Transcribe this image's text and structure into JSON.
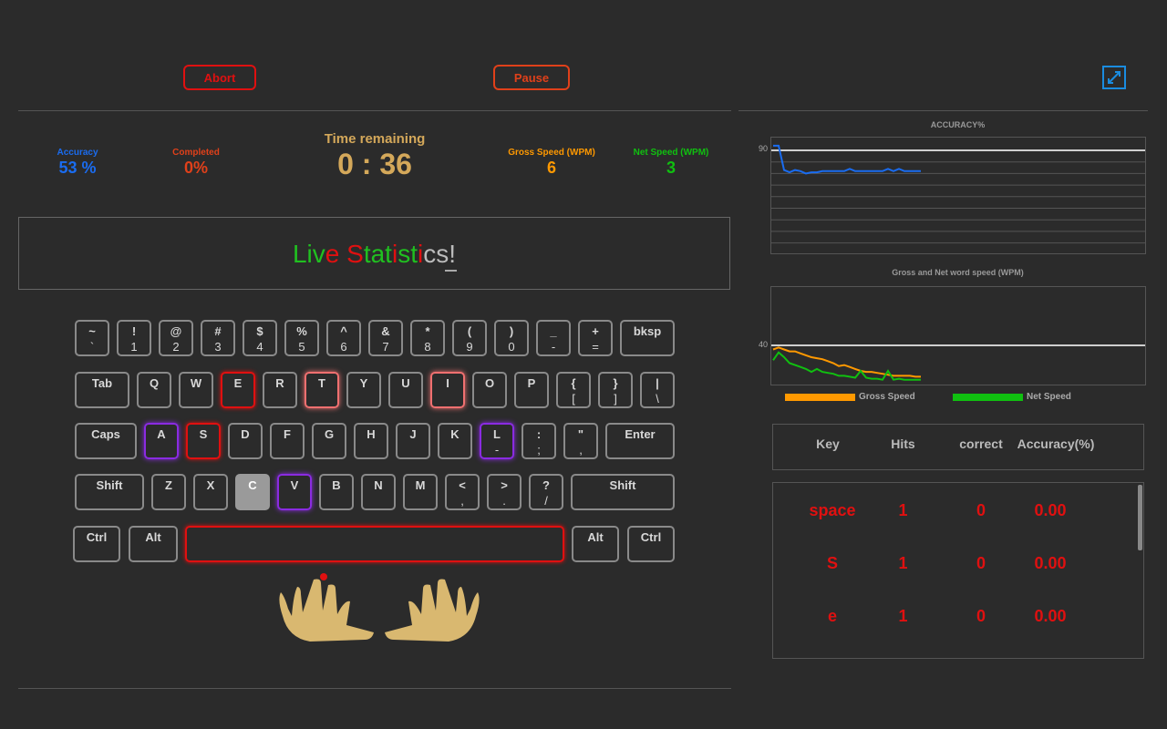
{
  "buttons": {
    "abort": "Abort",
    "pause": "Pause"
  },
  "stats": {
    "accuracy_label": "Accuracy",
    "accuracy_value": "53 %",
    "completed_label": "Completed",
    "completed_value": "0%",
    "time_label": "Time remaining",
    "time_value": "0 : 36",
    "gross_label": "Gross Speed (WPM)",
    "gross_value": "6",
    "net_label": "Net Speed (WPM)",
    "net_value": "3"
  },
  "live_text": {
    "segments": [
      {
        "text": "Liv",
        "color": "#20c020"
      },
      {
        "text": "e",
        "color": "#e01010"
      },
      {
        "text": " ",
        "color": "#d8d8d8"
      },
      {
        "text": "S",
        "color": "#e01010"
      },
      {
        "text": "tat",
        "color": "#20c020"
      },
      {
        "text": "i",
        "color": "#e01010"
      },
      {
        "text": "st",
        "color": "#20c020"
      },
      {
        "text": "i",
        "color": "#e01010"
      },
      {
        "text": "cs",
        "color": "#bbbbbb"
      },
      {
        "text": "!",
        "color": "#bbbbbb"
      }
    ]
  },
  "keyboard": {
    "row1": [
      [
        "~",
        "`"
      ],
      [
        "!",
        "1"
      ],
      [
        "@",
        "2"
      ],
      [
        "#",
        "3"
      ],
      [
        "$",
        "4"
      ],
      [
        "%",
        "5"
      ],
      [
        "^",
        "6"
      ],
      [
        "&",
        "7"
      ],
      [
        "*",
        "8"
      ],
      [
        "(",
        "9"
      ],
      [
        ")",
        "0"
      ],
      [
        "_",
        "-"
      ],
      [
        "+",
        "="
      ],
      [
        "bksp",
        ""
      ]
    ],
    "row2": [
      [
        "Tab",
        ""
      ],
      [
        "Q",
        ""
      ],
      [
        "W",
        ""
      ],
      [
        "E",
        ""
      ],
      [
        "R",
        ""
      ],
      [
        "T",
        ""
      ],
      [
        "Y",
        ""
      ],
      [
        "U",
        ""
      ],
      [
        "I",
        ""
      ],
      [
        "O",
        ""
      ],
      [
        "P",
        ""
      ],
      [
        "{",
        "["
      ],
      [
        "}",
        "]"
      ],
      [
        "|",
        "\\"
      ]
    ],
    "row3": [
      [
        "Caps",
        ""
      ],
      [
        "A",
        ""
      ],
      [
        "S",
        ""
      ],
      [
        "D",
        ""
      ],
      [
        "F",
        ""
      ],
      [
        "G",
        ""
      ],
      [
        "H",
        ""
      ],
      [
        "J",
        ""
      ],
      [
        "K",
        ""
      ],
      [
        "L",
        "-"
      ],
      [
        ":",
        ";"
      ],
      [
        "\"",
        ","
      ],
      [
        "Enter",
        ""
      ]
    ],
    "row4": [
      [
        "Shift",
        ""
      ],
      [
        "Z",
        ""
      ],
      [
        "X",
        ""
      ],
      [
        "C",
        ""
      ],
      [
        "V",
        ""
      ],
      [
        "B",
        ""
      ],
      [
        "N",
        ""
      ],
      [
        "M",
        ""
      ],
      [
        "<",
        ","
      ],
      [
        ">",
        "."
      ],
      [
        "?",
        "/"
      ],
      [
        "Shift",
        ""
      ]
    ],
    "row5": [
      [
        "Ctrl",
        ""
      ],
      [
        "Alt",
        ""
      ],
      [
        "",
        ""
      ],
      [
        "Alt",
        ""
      ],
      [
        "Ctrl",
        ""
      ]
    ]
  },
  "charts": {
    "accuracy": {
      "title": "ACCURACY%",
      "ytick": "90",
      "chart_data": {
        "type": "line",
        "series": [
          {
            "color": "#1a6cf0",
            "values": [
              93,
              93,
              72,
              70,
              72,
              71,
              69,
              70,
              70,
              71,
              71,
              71,
              71,
              71,
              73,
              71,
              71,
              71,
              71,
              71,
              71,
              73,
              71,
              73,
              71,
              71,
              71,
              71
            ]
          }
        ],
        "ylim": [
          0,
          100
        ]
      }
    },
    "speed": {
      "title": "Gross and Net word speed (WPM)",
      "ytick": "40",
      "legend_gross": "Gross Speed",
      "legend_net": "Net Speed",
      "gross_color": "#ff9900",
      "net_color": "#10c010",
      "chart_data": {
        "type": "line",
        "series": [
          {
            "name": "Gross Speed",
            "color": "#ff9900",
            "values": [
              36,
              38,
              36,
              34,
              34,
              32,
              30,
              28,
              27,
              26,
              24,
              22,
              19,
              20,
              18,
              16,
              14,
              13,
              13,
              12,
              11,
              10,
              9,
              9,
              9,
              9,
              8,
              8
            ]
          },
          {
            "name": "Net Speed",
            "color": "#10c010",
            "values": [
              25,
              33,
              28,
              22,
              20,
              18,
              16,
              13,
              16,
              13,
              12,
              11,
              9,
              9,
              8,
              7,
              14,
              7,
              6,
              6,
              5,
              14,
              5,
              6,
              5,
              5,
              5,
              5
            ]
          }
        ],
        "ylim": [
          0,
          100
        ]
      }
    }
  },
  "table": {
    "headers": [
      "Key",
      "Hits",
      "correct",
      "Accuracy(%)"
    ],
    "rows": [
      [
        "space",
        "1",
        "0",
        "0.00"
      ],
      [
        "S",
        "1",
        "0",
        "0.00"
      ],
      [
        "e",
        "1",
        "0",
        "0.00"
      ]
    ]
  }
}
